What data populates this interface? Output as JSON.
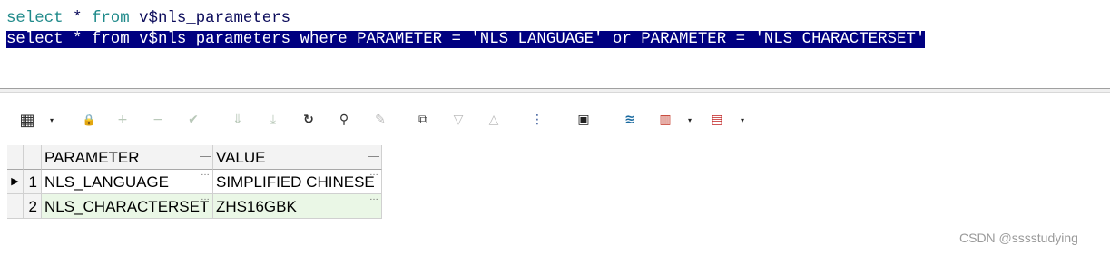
{
  "editor": {
    "line1": {
      "kw_select": "select",
      "star": " * ",
      "kw_from": "from",
      "rest": " v$nls_parameters"
    },
    "line2_selected": "select * from v$nls_parameters where PARAMETER = 'NLS_LANGUAGE' or PARAMETER = 'NLS_CHARACTERSET'"
  },
  "toolbar": {
    "icons": [
      "grid-layout-icon",
      "lock-icon",
      "add-record-icon",
      "delete-record-icon",
      "post-record-icon",
      "fetch-next-icon",
      "fetch-last-icon",
      "refresh-icon",
      "find-icon",
      "clear-icon",
      "export-icon",
      "move-down-icon",
      "move-up-icon",
      "query-plan-icon",
      "save-icon",
      "database-icon",
      "chart-icon",
      "table-export-icon"
    ],
    "glyphs": {
      "grid": "▦",
      "lock": "🔒",
      "add": "+",
      "minus": "−",
      "check": "✔",
      "next": "⇓",
      "last": "⤓",
      "refresh": "↻",
      "find": "⚲",
      "clear": "✎",
      "export": "⧉",
      "down": "▽",
      "up": "△",
      "plan": "⋮",
      "save": "▣",
      "db": "≋",
      "chart": "▥",
      "table": "▤",
      "drop": "▾"
    }
  },
  "grid": {
    "columns": [
      "PARAMETER",
      "VALUE"
    ],
    "rows": [
      {
        "num": "1",
        "parameter": "NLS_LANGUAGE",
        "value": "SIMPLIFIED CHINESE",
        "current": "▶"
      },
      {
        "num": "2",
        "parameter": "NLS_CHARACTERSET",
        "value": "ZHS16GBK",
        "current": ""
      }
    ],
    "ellipsis": "…"
  },
  "watermark": "CSDN @sssstudying",
  "colors": {
    "keyword": "#1f8a8a",
    "selection": "#000080",
    "row_alt": "#eaf7e6"
  }
}
